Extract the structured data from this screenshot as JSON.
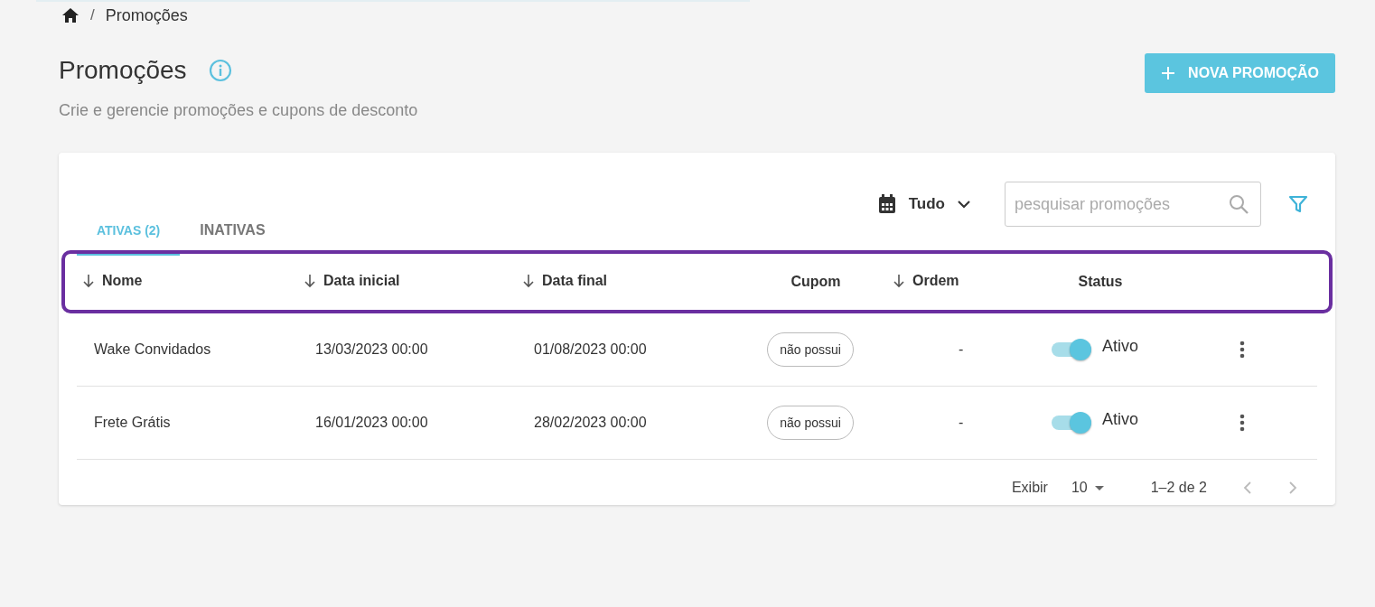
{
  "breadcrumb": {
    "separator": "/",
    "current": "Promoções"
  },
  "header": {
    "title": "Promoções",
    "subtitle": "Crie e gerencie promoções e cupons de desconto",
    "new_button": "NOVA PROMOÇÃO"
  },
  "tabs": [
    {
      "label": "ATIVAS (2)",
      "selected": true
    },
    {
      "label": "INATIVAS",
      "selected": false
    }
  ],
  "date_filter": {
    "value": "Tudo"
  },
  "search": {
    "placeholder": "pesquisar promoções"
  },
  "table": {
    "columns": [
      {
        "label": "Nome",
        "sortable": true
      },
      {
        "label": "Data inicial",
        "sortable": true
      },
      {
        "label": "Data final",
        "sortable": true
      },
      {
        "label": "Cupom",
        "sortable": false
      },
      {
        "label": "Ordem",
        "sortable": true
      },
      {
        "label": "Status",
        "sortable": false
      }
    ],
    "rows": [
      {
        "name": "Wake Convidados",
        "start": "13/03/2023 00:00",
        "end": "01/08/2023 00:00",
        "coupon": "não possui",
        "order": "-",
        "status": "Ativo",
        "on": true
      },
      {
        "name": "Frete Grátis",
        "start": "16/01/2023 00:00",
        "end": "28/02/2023 00:00",
        "coupon": "não possui",
        "order": "-",
        "status": "Ativo",
        "on": true
      }
    ]
  },
  "pagination": {
    "label": "Exibir",
    "per_page": "10",
    "range": "1–2 de 2",
    "prev_disabled": true,
    "next_disabled": true
  }
}
